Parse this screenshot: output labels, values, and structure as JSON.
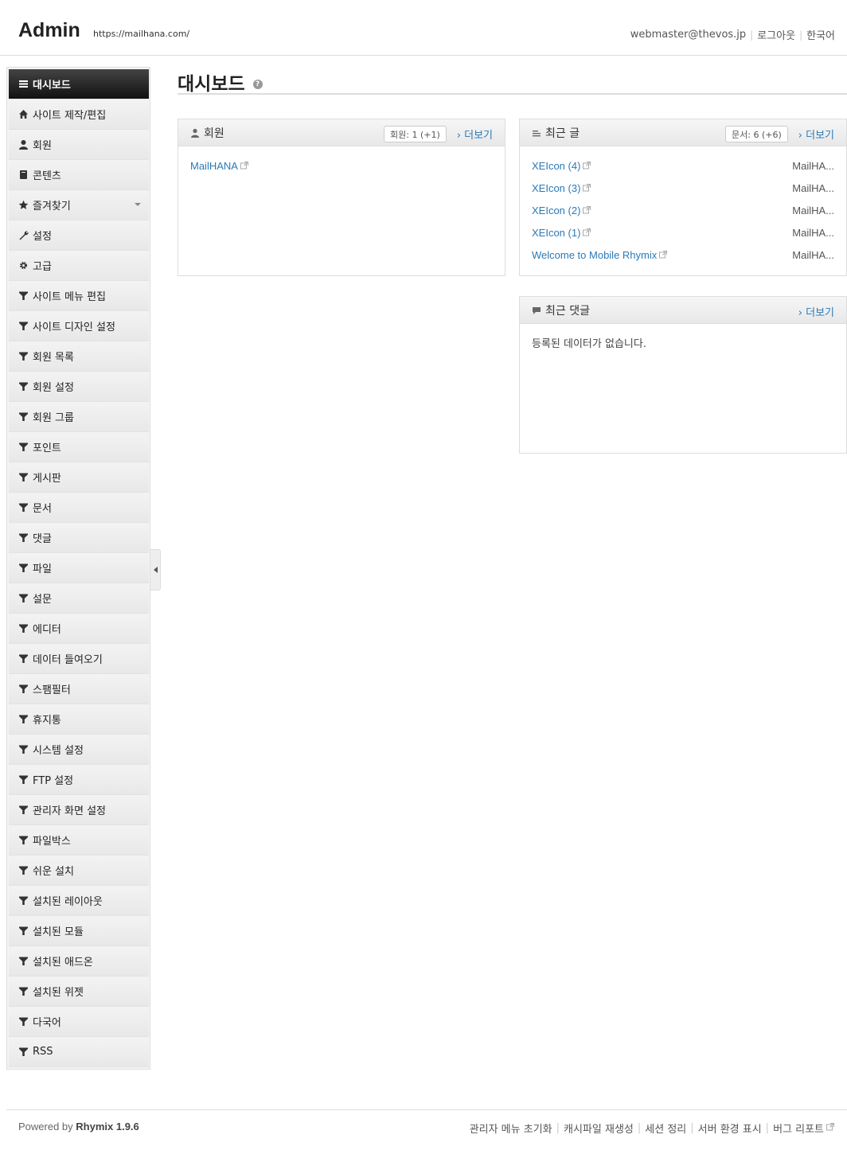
{
  "header": {
    "logo": "Admin",
    "site_url": "https://mailhana.com/",
    "email": "webmaster@thevos.jp",
    "logout": "로그아웃",
    "language": "한국어"
  },
  "sidebar": {
    "items": [
      {
        "label": "대시보드",
        "icon": "list-icon"
      },
      {
        "label": "사이트 제작/편집",
        "icon": "home-icon"
      },
      {
        "label": "회원",
        "icon": "user-icon"
      },
      {
        "label": "콘텐츠",
        "icon": "book-icon"
      },
      {
        "label": "즐겨찾기",
        "icon": "star-icon"
      },
      {
        "label": "설정",
        "icon": "wrench-icon"
      },
      {
        "label": "고급",
        "icon": "gear-icon"
      },
      {
        "label": "사이트 메뉴 편집",
        "icon": "filter-icon"
      },
      {
        "label": "사이트 디자인 설정",
        "icon": "filter-icon"
      },
      {
        "label": "회원 목록",
        "icon": "filter-icon"
      },
      {
        "label": "회원 설정",
        "icon": "filter-icon"
      },
      {
        "label": "회원 그룹",
        "icon": "filter-icon"
      },
      {
        "label": "포인트",
        "icon": "filter-icon"
      },
      {
        "label": "게시판",
        "icon": "filter-icon"
      },
      {
        "label": "문서",
        "icon": "filter-icon"
      },
      {
        "label": "댓글",
        "icon": "filter-icon"
      },
      {
        "label": "파일",
        "icon": "filter-icon"
      },
      {
        "label": "설문",
        "icon": "filter-icon"
      },
      {
        "label": "에디터",
        "icon": "filter-icon"
      },
      {
        "label": "데이터 들여오기",
        "icon": "filter-icon"
      },
      {
        "label": "스팸필터",
        "icon": "filter-icon"
      },
      {
        "label": "휴지통",
        "icon": "filter-icon"
      },
      {
        "label": "시스템 설정",
        "icon": "filter-icon"
      },
      {
        "label": "FTP 설정",
        "icon": "filter-icon"
      },
      {
        "label": "관리자 화면 설정",
        "icon": "filter-icon"
      },
      {
        "label": "파일박스",
        "icon": "filter-icon"
      },
      {
        "label": "쉬운 설치",
        "icon": "filter-icon"
      },
      {
        "label": "설치된 레이아웃",
        "icon": "filter-icon"
      },
      {
        "label": "설치된 모듈",
        "icon": "filter-icon"
      },
      {
        "label": "설치된 애드온",
        "icon": "filter-icon"
      },
      {
        "label": "설치된 위젯",
        "icon": "filter-icon"
      },
      {
        "label": "다국어",
        "icon": "filter-icon"
      },
      {
        "label": "RSS",
        "icon": "filter-icon"
      }
    ]
  },
  "main": {
    "title": "대시보드",
    "help": "?"
  },
  "members_panel": {
    "title": "회원",
    "badge": "회원: 1 (+1)",
    "more": "› 더보기",
    "members": [
      "MailHANA"
    ]
  },
  "recent_posts_panel": {
    "title": "최근 글",
    "badge": "문서: 6 (+6)",
    "more": "› 더보기",
    "posts": [
      {
        "title": "XEIcon (4)",
        "author": "MailHA..."
      },
      {
        "title": "XEIcon (3)",
        "author": "MailHA..."
      },
      {
        "title": "XEIcon (2)",
        "author": "MailHA..."
      },
      {
        "title": "XEIcon (1)",
        "author": "MailHA..."
      },
      {
        "title": "Welcome to Mobile Rhymix",
        "author": "MailHA..."
      }
    ]
  },
  "recent_comments_panel": {
    "title": "최근 댓글",
    "more": "› 더보기",
    "empty": "등록된 데이터가 없습니다."
  },
  "footer": {
    "powered_prefix": "Powered by",
    "powered_name": "Rhymix 1.9.6",
    "links": [
      "관리자 메뉴 초기화",
      "캐시파일 재생성",
      "세션 정리",
      "서버 환경 표시",
      "버그 리포트"
    ]
  },
  "colors": {
    "link": "#2a7ab7",
    "active_nav": "#1a1a1a"
  }
}
